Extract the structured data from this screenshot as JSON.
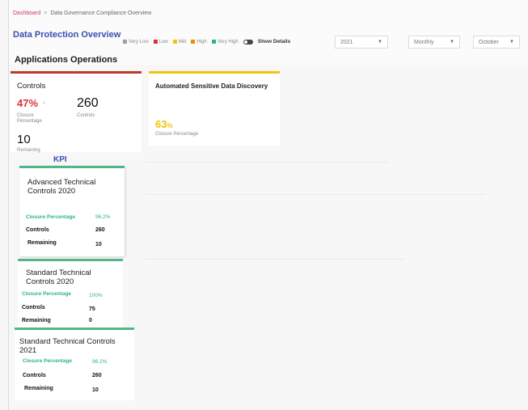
{
  "breadcrumb": {
    "home": "Dashboard",
    "separator": ">",
    "current": "Data Governance Compliance Overview"
  },
  "page_title": "Data Protection Overview",
  "section_title": "Applications Operations",
  "legend": {
    "items": [
      {
        "label": "Very Low",
        "color": "#9e9e9e"
      },
      {
        "label": "Low",
        "color": "#e03131"
      },
      {
        "label": "Mid",
        "color": "#f4c20d"
      },
      {
        "label": "High",
        "color": "#f08c00"
      },
      {
        "label": "Very High",
        "color": "#2eb67d"
      }
    ],
    "show_details_label": "Show Details"
  },
  "filters": {
    "year": "2021",
    "period": "Monthly",
    "month": "October"
  },
  "controls_card": {
    "title": "Controls",
    "closure_pct": "47%",
    "closure_trend": "-",
    "closure_label": "Closure Percentage",
    "controls_value": "260",
    "controls_label": "Controls",
    "remaining_value": "10",
    "remaining_label": "Remaining"
  },
  "asd_card": {
    "title": "Automated Sensitive Data Discovery",
    "closure_pct": "63",
    "pct_sign": "%",
    "closure_label": "Closure Percentage"
  },
  "kpi_label": "KPI",
  "kpi_cards": [
    {
      "title": "Advanced Technical Controls 2020",
      "closure_label": "Closure Percentage",
      "closure_value": "96.2%",
      "controls_label": "Controls",
      "controls_value": "260",
      "remaining_label": "Remaining",
      "remaining_value": "10"
    },
    {
      "title": "Standard Technical Controls 2020",
      "closure_label": "Closure Percentage",
      "closure_value": "100%",
      "controls_label": "Controls",
      "controls_value": "75",
      "remaining_label": "Remaining",
      "remaining_value": "0"
    },
    {
      "title": "Standard Technical Controls 2021",
      "closure_label": "Closure Percentage",
      "closure_value": "96.2%",
      "controls_label": "Controls",
      "controls_value": "260",
      "remaining_label": "Remaining",
      "remaining_value": "10"
    }
  ]
}
